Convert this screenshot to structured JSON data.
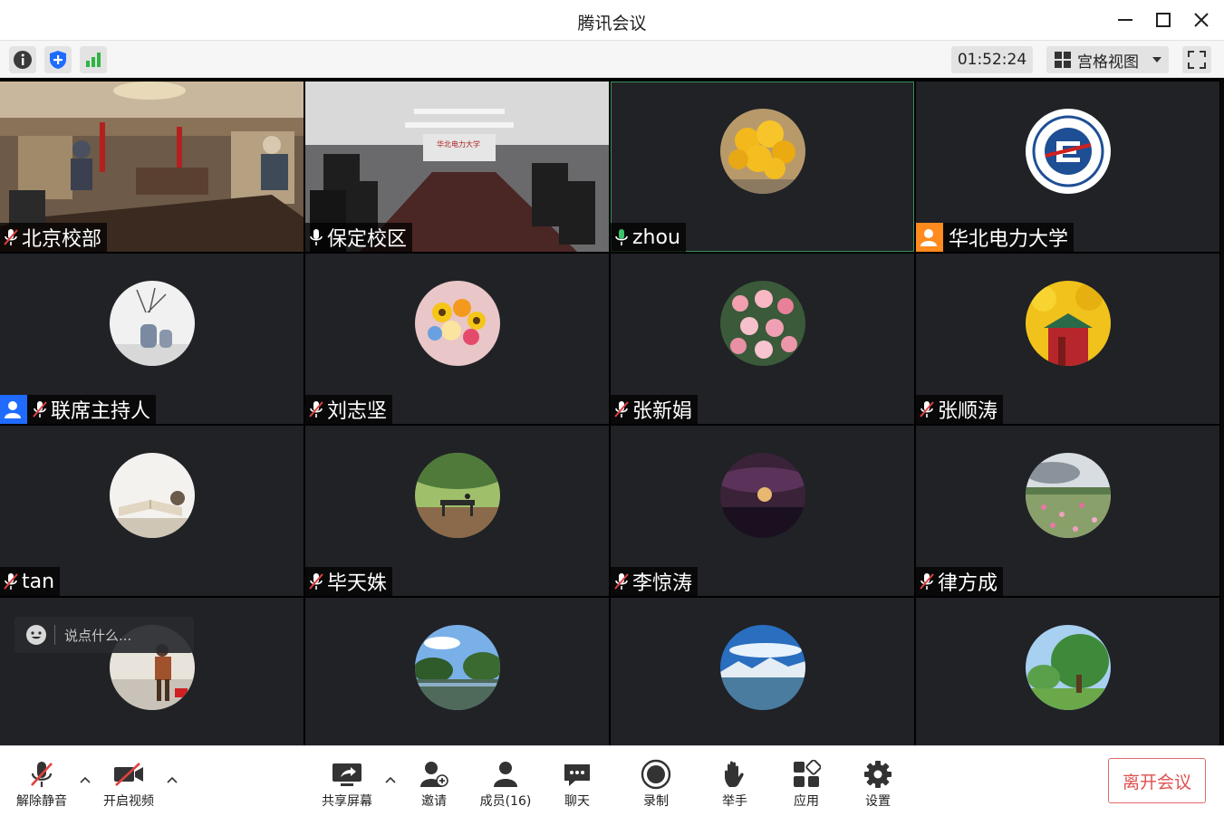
{
  "window": {
    "title": "腾讯会议"
  },
  "infobar": {
    "timer": "01:52:24",
    "view_label": "宫格视图"
  },
  "tiles": [
    {
      "name": "北京校部",
      "mic": "muted",
      "kind": "video-room1"
    },
    {
      "name": "保定校区",
      "mic": "on",
      "kind": "video-room2"
    },
    {
      "name": "zhou",
      "mic": "speaking",
      "kind": "avatar-yellow-flowers"
    },
    {
      "name": "华北电力大学",
      "mic": "host",
      "kind": "avatar-logo"
    },
    {
      "name": "联席主持人",
      "mic": "muted-cohost",
      "kind": "avatar-vase"
    },
    {
      "name": "刘志坚",
      "mic": "muted",
      "kind": "avatar-bouquet"
    },
    {
      "name": "张新娟",
      "mic": "muted",
      "kind": "avatar-pink-flowers"
    },
    {
      "name": "张顺涛",
      "mic": "muted",
      "kind": "avatar-ginkgo"
    },
    {
      "name": "tan",
      "mic": "muted",
      "kind": "avatar-book"
    },
    {
      "name": "毕天姝",
      "mic": "muted",
      "kind": "avatar-bench"
    },
    {
      "name": "李惊涛",
      "mic": "muted",
      "kind": "avatar-moon"
    },
    {
      "name": "律方成",
      "mic": "muted",
      "kind": "avatar-field"
    },
    {
      "name": "",
      "mic": "muted",
      "kind": "avatar-hiker"
    },
    {
      "name": "",
      "mic": "muted",
      "kind": "avatar-lake"
    },
    {
      "name": "",
      "mic": "muted",
      "kind": "avatar-mountain"
    },
    {
      "name": "",
      "mic": "muted",
      "kind": "avatar-tree"
    }
  ],
  "chat": {
    "placeholder": "说点什么..."
  },
  "toolbar": {
    "unmute": "解除静音",
    "start_video": "开启视频",
    "share_screen": "共享屏幕",
    "invite": "邀请",
    "members": "成员(16)",
    "chat": "聊天",
    "record": "录制",
    "raise_hand": "举手",
    "apps": "应用",
    "settings": "设置",
    "leave": "离开会议"
  },
  "colors": {
    "accent_blue": "#1f6bff",
    "speaking_green": "#3ac36a",
    "host_orange": "#ff8a1e",
    "leave_red": "#e05050"
  }
}
